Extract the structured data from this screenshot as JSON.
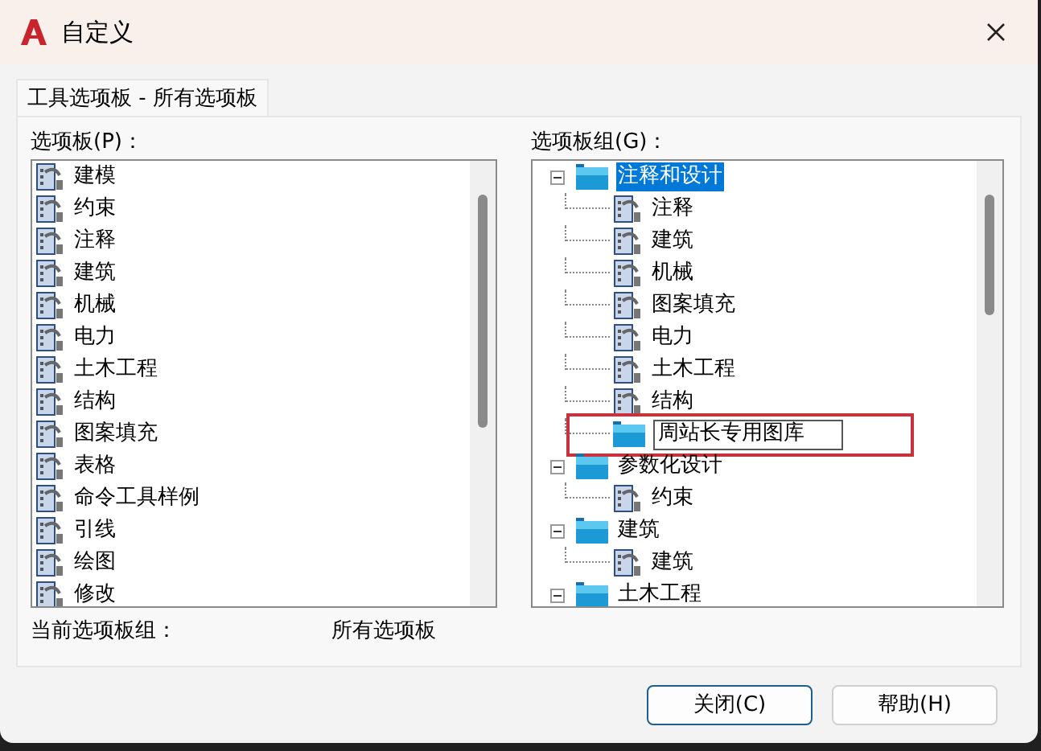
{
  "window": {
    "title": "自定义"
  },
  "tabs": [
    {
      "label": "工具选项板 - 所有选项板",
      "selected": true
    }
  ],
  "palettes": {
    "label": "选项板(P)：",
    "items": [
      {
        "label": "建模"
      },
      {
        "label": "约束"
      },
      {
        "label": "注释"
      },
      {
        "label": "建筑"
      },
      {
        "label": "机械"
      },
      {
        "label": "电力"
      },
      {
        "label": "土木工程"
      },
      {
        "label": "结构"
      },
      {
        "label": "图案填充"
      },
      {
        "label": "表格"
      },
      {
        "label": "命令工具样例"
      },
      {
        "label": "引线"
      },
      {
        "label": "绘图"
      },
      {
        "label": "修改"
      }
    ]
  },
  "palette_groups": {
    "label": "选项板组(G)：",
    "tree": [
      {
        "kind": "group",
        "label": "注释和设计",
        "expanded": true,
        "selected": true,
        "children": [
          {
            "kind": "palette",
            "label": "注释"
          },
          {
            "kind": "palette",
            "label": "建筑"
          },
          {
            "kind": "palette",
            "label": "机械"
          },
          {
            "kind": "palette",
            "label": "图案填充"
          },
          {
            "kind": "palette",
            "label": "电力"
          },
          {
            "kind": "palette",
            "label": "土木工程"
          },
          {
            "kind": "palette",
            "label": "结构"
          },
          {
            "kind": "group",
            "label": "周站长专用图库",
            "editing": true,
            "highlighted": true
          }
        ]
      },
      {
        "kind": "group",
        "label": "参数化设计",
        "expanded": true,
        "selected": false,
        "children": [
          {
            "kind": "palette",
            "label": "约束"
          }
        ]
      },
      {
        "kind": "group",
        "label": "建筑",
        "expanded": true,
        "selected": false,
        "children": [
          {
            "kind": "palette",
            "label": "建筑"
          }
        ]
      },
      {
        "kind": "group",
        "label": "土木工程",
        "expanded": true,
        "selected": false
      }
    ]
  },
  "current_group": {
    "label": "当前选项板组：",
    "value": "所有选项板"
  },
  "buttons": [
    {
      "label": "关闭(C)",
      "default": true
    },
    {
      "label": "帮助(H)",
      "default": false
    }
  ]
}
